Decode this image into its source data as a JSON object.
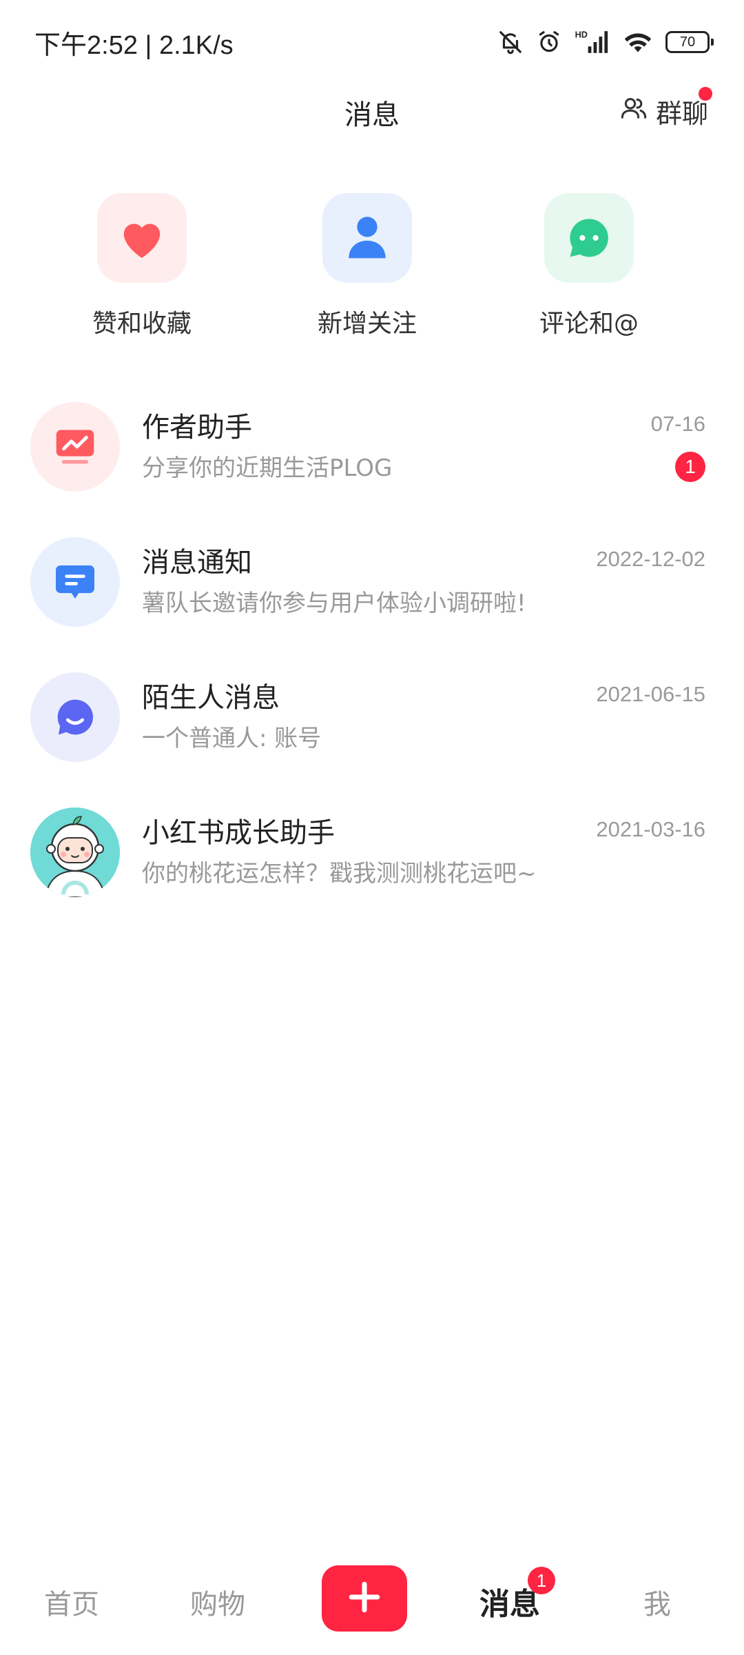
{
  "status_bar": {
    "time": "下午2:52 | 2.1K/s",
    "battery": "70",
    "icons": [
      "bell-off-icon",
      "alarm-icon",
      "hd-signal-icon",
      "wifi-icon",
      "battery-icon"
    ]
  },
  "header": {
    "title": "消息",
    "group_chat_label": "群聊"
  },
  "quick_entries": [
    {
      "label": "赞和收藏",
      "icon": "heart-icon",
      "color": "#ff5a5f",
      "bg": "#ffecec"
    },
    {
      "label": "新增关注",
      "icon": "person-icon",
      "color": "#3b82f6",
      "bg": "#e8f0fe"
    },
    {
      "label": "评论和@",
      "icon": "chat-bubble-icon",
      "color": "#2ecc8f",
      "bg": "#e6f8ef"
    }
  ],
  "messages": [
    {
      "title": "作者助手",
      "subtitle": "分享你的近期生活PLOG",
      "date": "07-16",
      "badge": "1",
      "icon": "chart-icon"
    },
    {
      "title": "消息通知",
      "subtitle": "薯队长邀请你参与用户体验小调研啦!",
      "date": "2022-12-02",
      "icon": "notification-icon"
    },
    {
      "title": "陌生人消息",
      "subtitle": "一个普通人: 账号",
      "date": "2021-06-15",
      "icon": "stranger-chat-icon"
    },
    {
      "title": "小红书成长助手",
      "subtitle": "你的桃花运怎样？戳我测测桃花运吧~",
      "date": "2021-03-16",
      "icon": "astronaut-avatar"
    }
  ],
  "tabbar": {
    "home": "首页",
    "shop": "购物",
    "messages": "消息",
    "messages_badge": "1",
    "me": "我"
  },
  "colors": {
    "accent": "#ff2442"
  }
}
